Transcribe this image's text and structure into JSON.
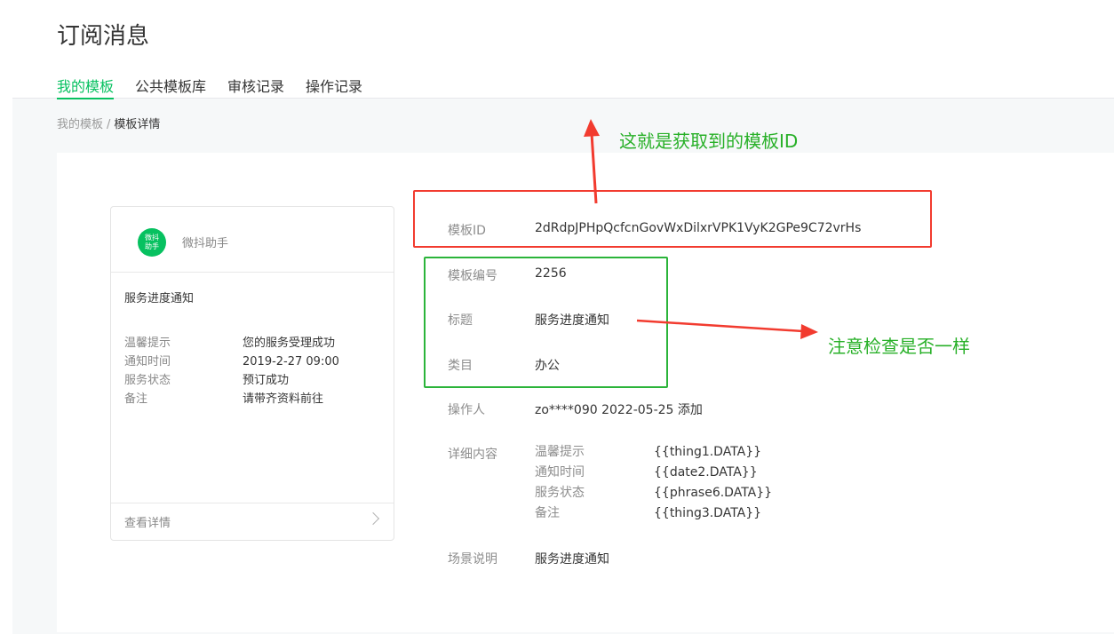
{
  "page": {
    "title": "订阅消息",
    "tabs": [
      "我的模板",
      "公共模板库",
      "审核记录",
      "操作记录"
    ],
    "active_tab": "我的模板"
  },
  "breadcrumb": {
    "parent": "我的模板",
    "separator": "/",
    "current": "模板详情"
  },
  "preview_card": {
    "logo_text_line1": "微抖",
    "logo_text_line2": "助手",
    "app_name": "微抖助手",
    "message_title": "服务进度通知",
    "fields": [
      {
        "key": "温馨提示",
        "value": "您的服务受理成功"
      },
      {
        "key": "通知时间",
        "value": "2019-2-27 09:00"
      },
      {
        "key": "服务状态",
        "value": "预订成功"
      },
      {
        "key": "备注",
        "value": "请带齐资料前往"
      }
    ],
    "footer_link": "查看详情",
    "footer_icon": "chevron-right-icon"
  },
  "details": {
    "template_id": {
      "label": "模板ID",
      "value": "2dRdpJPHpQcfcnGovWxDilxrVPK1VyK2GPe9C72vrHs"
    },
    "template_no": {
      "label": "模板编号",
      "value": "2256"
    },
    "title": {
      "label": "标题",
      "value": "服务进度通知"
    },
    "category": {
      "label": "类目",
      "value": "办公"
    },
    "operator": {
      "label": "操作人",
      "value": "zo****090 2022-05-25 添加"
    },
    "content": {
      "label": "详细内容",
      "rows": [
        {
          "key": "温馨提示",
          "value": "{{thing1.DATA}}"
        },
        {
          "key": "通知时间",
          "value": "{{date2.DATA}}"
        },
        {
          "key": "服务状态",
          "value": "{{phrase6.DATA}}"
        },
        {
          "key": "备注",
          "value": "{{thing3.DATA}}"
        }
      ]
    },
    "scene": {
      "label": "场景说明",
      "value": "服务进度通知"
    }
  },
  "annotations": {
    "id_note": "这就是获取到的模板ID",
    "check_note": "注意检查是否一样",
    "red_color": "#f23b2f",
    "green_color": "#2bb43a"
  },
  "colors": {
    "accent": "#07c160",
    "text": "#353535",
    "muted": "#8d8d8d",
    "background": "#f6f8f9"
  }
}
